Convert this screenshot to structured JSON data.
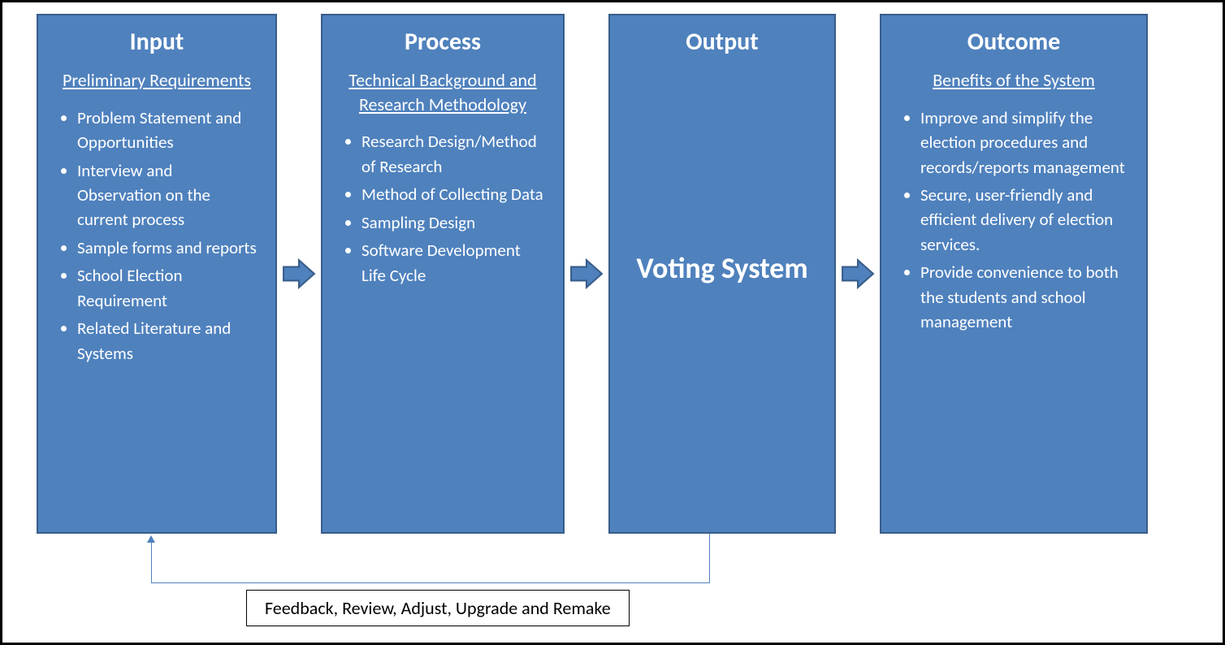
{
  "boxes": {
    "input": {
      "title": "Input",
      "subtitle": "Preliminary Requirements",
      "items": [
        "Problem Statement and Opportunities",
        "Interview and Observation on the current process",
        "Sample forms and reports",
        "School Election Requirement",
        "Related Literature and Systems"
      ]
    },
    "process": {
      "title": "Process",
      "subtitle": "Technical Background and Research Methodology",
      "items": [
        "Research Design/Method of Research",
        "Method of Collecting Data",
        "Sampling Design",
        "Software Development Life Cycle"
      ]
    },
    "output": {
      "title": "Output",
      "center_text": "Voting System"
    },
    "outcome": {
      "title": "Outcome",
      "subtitle": "Benefits of the System",
      "items": [
        "Improve and simplify the election procedures and records/reports management",
        "Secure, user-friendly and efficient delivery of election services.",
        "Provide convenience to both the students and school management"
      ]
    }
  },
  "feedback_label": "Feedback, Review, Adjust, Upgrade and Remake",
  "colors": {
    "box_fill": "#4f81bd",
    "box_border": "#385d8a",
    "arrow_fill": "#4f81bd",
    "arrow_border": "#385d8a"
  }
}
